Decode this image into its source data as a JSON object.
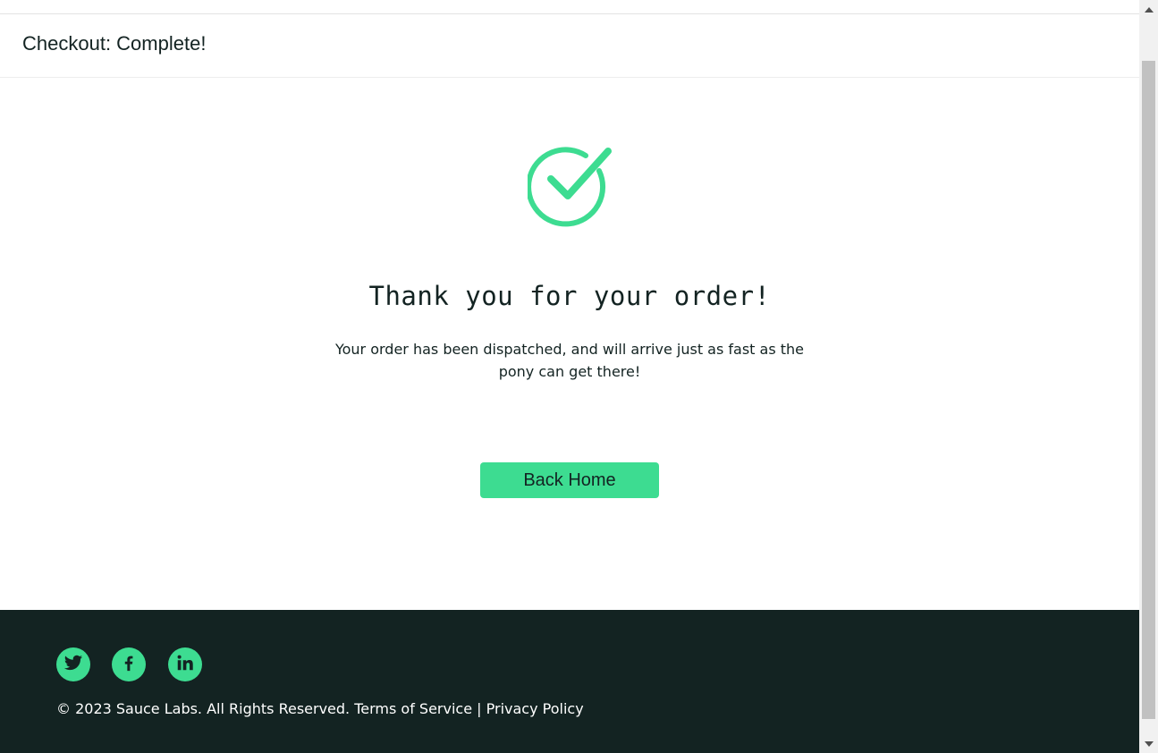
{
  "subheader": {
    "title": "Checkout: Complete!"
  },
  "complete": {
    "icon": "checkmark-circle-icon",
    "header": "Thank you for your order!",
    "text": "Your order has been dispatched, and will arrive just as fast as the pony can get there!",
    "back_button_label": "Back Home"
  },
  "footer": {
    "social": [
      {
        "name": "Twitter",
        "icon": "twitter-icon"
      },
      {
        "name": "Facebook",
        "icon": "facebook-icon"
      },
      {
        "name": "LinkedIn",
        "icon": "linkedin-icon"
      }
    ],
    "copyright": "© 2023 Sauce Labs. All Rights Reserved. Terms of Service | Privacy Policy"
  },
  "colors": {
    "accent": "#3ddc91",
    "footer_bg": "#132322",
    "text": "#132322"
  }
}
